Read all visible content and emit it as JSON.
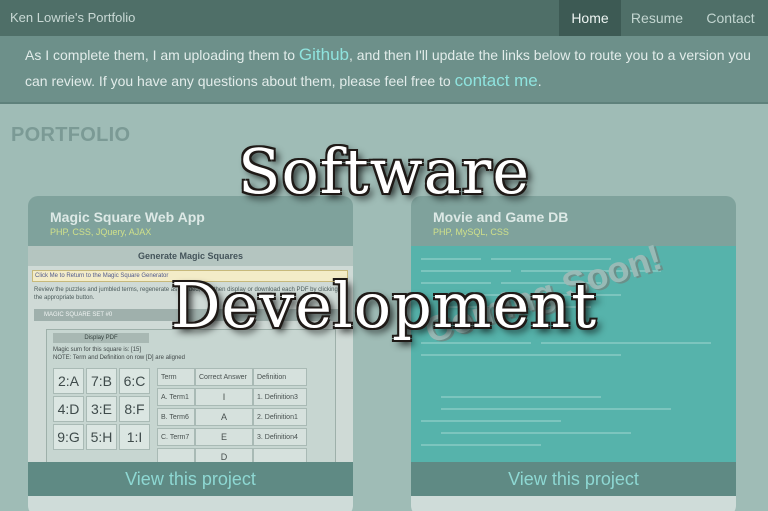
{
  "navbar": {
    "brand": "Ken Lowrie's Portfolio",
    "items": [
      {
        "label": "Home",
        "active": true
      },
      {
        "label": "Resume",
        "active": false
      },
      {
        "label": "Contact",
        "active": false
      }
    ]
  },
  "intro": {
    "part1": "As I complete them, I am uploading them to ",
    "link1": "Github",
    "part2": ", and then I'll update the links below to route you to a version you can review. If you have any questions about them, please feel free to ",
    "link2": "contact me",
    "part3": "."
  },
  "page_title": "PORTFOLIO",
  "cards": [
    {
      "title": "Magic Square Web App",
      "tech": "PHP, CSS, JQuery, AJAX",
      "view_label": "View this project",
      "preview": {
        "header": "Generate Magic Squares",
        "notice": "Click Me to Return to the Magic Square Generator",
        "desc": "Review the puzzles and jumbled terms, regenerate as needed, and then display or download each PDF by clicking the appropriate button.",
        "set_label": "MAGIC SQUARE SET #0",
        "pdf_button": "Display PDF",
        "note_line1": "Magic sum for this square is: [15]",
        "note_line2": "NOTE: Term and Definition on row [D] are aligned",
        "cells": [
          "2:A",
          "7:B",
          "6:C",
          "4:D",
          "3:E",
          "8:F",
          "9:G",
          "5:H",
          "1:I"
        ],
        "table_headers": [
          "Term",
          "Correct Answer",
          "Definition"
        ],
        "table_rows": [
          [
            "A. Term1",
            "I",
            "1. Definition3"
          ],
          [
            "B. Term6",
            "A",
            "2. Definition1"
          ],
          [
            "C. Term7",
            "E",
            "3. Definition4"
          ],
          [
            "",
            "D",
            ""
          ]
        ]
      }
    },
    {
      "title": "Movie and Game DB",
      "tech": "PHP, MySQL, CSS",
      "view_label": "View this project",
      "badge": "Coming Soon!"
    }
  ],
  "overlay": {
    "line1": "Software",
    "line2": "Development"
  },
  "colors": {
    "navbar": "#4f6f68",
    "accent_link": "#8fe3de",
    "tech_text": "#cfe08a"
  }
}
